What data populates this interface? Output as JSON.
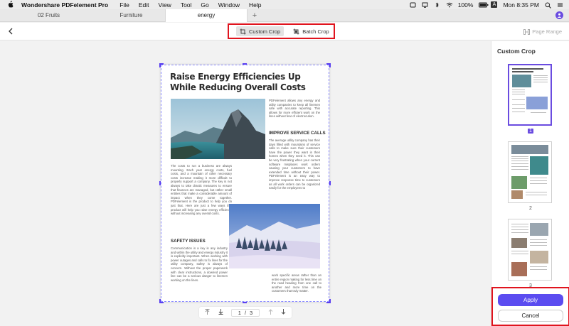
{
  "menubar": {
    "app_name": "Wondershare PDFelement Pro",
    "items": [
      "File",
      "Edit",
      "View",
      "Tool",
      "Go",
      "Window",
      "Help"
    ],
    "battery": "100%",
    "clock": "Mon 8:35 PM",
    "input_letter": "A"
  },
  "tabs": [
    {
      "label": "02 Fruits",
      "active": false
    },
    {
      "label": "Furniture",
      "active": false
    },
    {
      "label": "energy",
      "active": true
    }
  ],
  "tab_add_label": "+",
  "toolbar": {
    "custom_crop_label": "Custom Crop",
    "batch_crop_label": "Batch Crop",
    "page_range_label": "Page Range"
  },
  "document": {
    "title": "Raise Energy Efficiencies Up While Reducing Overall Costs",
    "p_intro_right": "PDFelement allows any energy and utility companies to keep all linemen safe with accurate reporting. This allows for more efficient work on the lines without fear of electrocution.",
    "heading_service": "IMPROVE SERVICE CALLS",
    "p_service": "The average utility company has their days filled with mountains of service calls to make sure their customers have the power they want in their homes when they need it. This can be very frustrating when your current software misplaces work orders causing your customers to have extended time without their power. PDFelement is an easy way to improve response time to customers as all work orders can be organized easily for the employees to",
    "p_left": "The costs to run a business are always mounting. Each year energy costs, fuel costs, and a mountain of other necessary costs increase making it more difficult to properly support a company. The key is not always to take drastic measures to ensure that finances are managed, but rather small entities that make a considerable amount of impact when they come together. PDFelement is the product to help you do just that. Here are just a few ways this product will help you raise energy efficiency without increasing any overall costs.",
    "heading_safety": "SAFETY ISSUES",
    "p_safety": "Communication is a key in any industry and within the utility and energy industry it is explicitly important. When working with power outages and calls to fix lines for the utility company, safety is always of concern. Without the proper paperwork with clear instructions, a dowired power line can be a serious danger to linemen working on the lines.",
    "p_bottom_right": "work specific areas rather than an entire region making for less time on the road heading from one call to another and more time on the customers that truly matter."
  },
  "pager": {
    "current": "1",
    "separator": "/",
    "total": "3"
  },
  "sidebar": {
    "title": "Custom Crop",
    "thumbnails": [
      {
        "number": "1",
        "selected": true
      },
      {
        "number": "2",
        "selected": false
      },
      {
        "number": "3",
        "selected": false
      }
    ],
    "apply_label": "Apply",
    "cancel_label": "Cancel"
  },
  "colors": {
    "accent": "#5b4cf0",
    "highlight_red": "#e0141e"
  }
}
